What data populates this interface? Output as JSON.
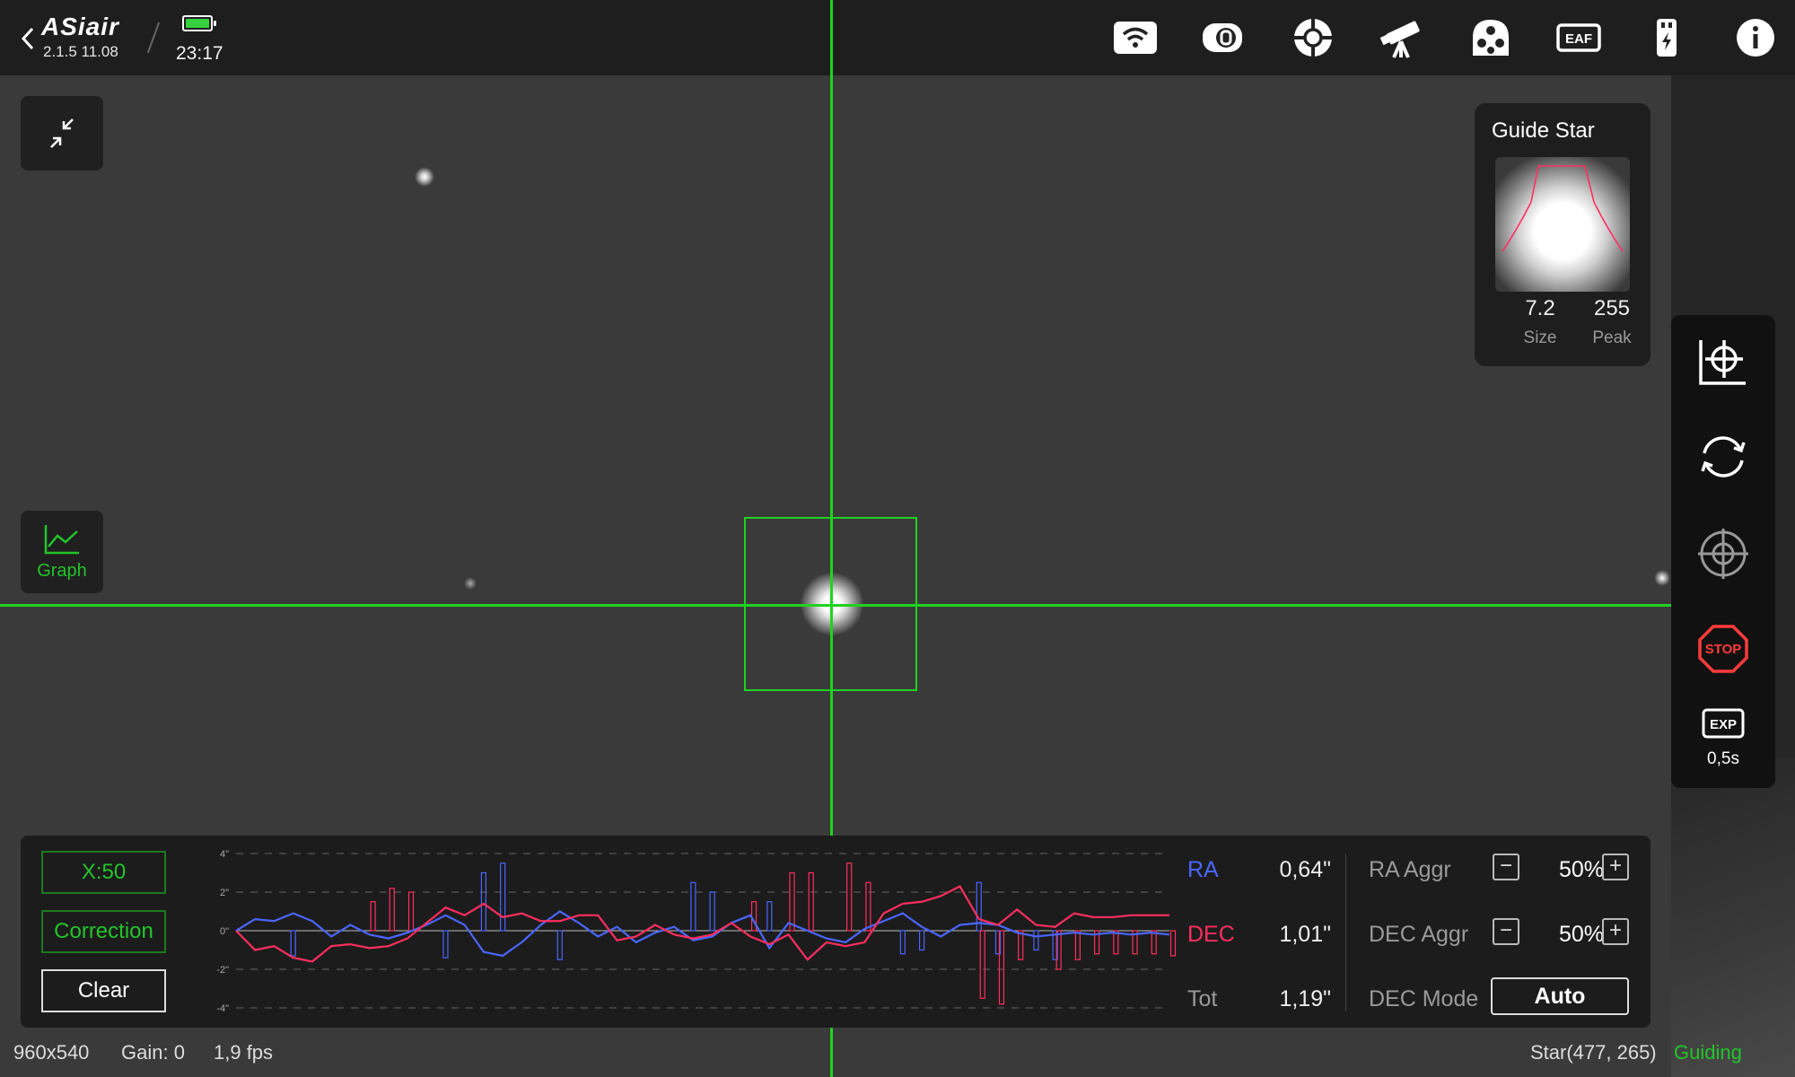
{
  "app": {
    "logo": "ASiair",
    "version": "2.1.5 11.08",
    "time": "23:17"
  },
  "top_icons": [
    "wifi-icon",
    "camera-icon",
    "guide-camera-icon",
    "telescope-icon",
    "filter-wheel-icon",
    "focuser-icon",
    "storage-icon",
    "info-icon"
  ],
  "top_icon_labels": {
    "focuser": "EAF"
  },
  "guide_star": {
    "title": "Guide Star",
    "size_value": "7.2",
    "size_label": "Size",
    "peak_value": "255",
    "peak_label": "Peak"
  },
  "graph_button": {
    "label": "Graph"
  },
  "panel": {
    "x_scale": "X:50",
    "correction": "Correction",
    "clear": "Clear",
    "ra_label": "RA",
    "ra_value": "0,64\"",
    "dec_label": "DEC",
    "dec_value": "1,01\"",
    "tot_label": "Tot",
    "tot_value": "1,19\"",
    "ra_aggr_label": "RA Aggr",
    "ra_aggr_value": "50%",
    "dec_aggr_label": "DEC Aggr",
    "dec_aggr_value": "50%",
    "dec_mode_label": "DEC Mode",
    "dec_mode_value": "Auto"
  },
  "side_tools": {
    "exp_label": "EXP",
    "exp_value": "0,5s",
    "stop_label": "STOP"
  },
  "status": {
    "resolution": "960x540",
    "gain": "Gain: 0",
    "fps": "1,9 fps",
    "star": "Star(477, 265)",
    "state": "Guiding"
  },
  "colors": {
    "green": "#1fd31f",
    "ra": "#4a66ff",
    "dec": "#ff2e5f",
    "stop": "#ff3b3b"
  },
  "chart_data": {
    "type": "line",
    "y_ticks": [
      "4\"",
      "2\"",
      "0\"",
      "-2\"",
      "-4\""
    ],
    "ylim": [
      -4,
      4
    ],
    "series": [
      {
        "name": "RA",
        "values": [
          0,
          0.6,
          0.5,
          0.9,
          0.5,
          -0.3,
          0.3,
          -0.2,
          -0.4,
          -0.1,
          0.3,
          0.8,
          0.3,
          -1.1,
          -1.3,
          -0.6,
          0.3,
          1.0,
          0.4,
          -0.3,
          0.2,
          -0.6,
          -0.1,
          0.2,
          -0.5,
          -0.3,
          0.4,
          0.8,
          -0.9,
          0.4,
          0.0,
          -0.4,
          -0.6,
          0.1,
          0.5,
          0.9,
          0.2,
          -0.3,
          0.3,
          0.4,
          0.3,
          -0.1,
          -0.3,
          -0.2,
          -0.1,
          -0.2,
          -0.1,
          -0.2,
          -0.1,
          -0.2
        ]
      },
      {
        "name": "DEC",
        "values": [
          0,
          -1.0,
          -0.8,
          -1.4,
          -1.6,
          -0.8,
          -0.7,
          -0.9,
          -0.8,
          -0.4,
          0.4,
          1.2,
          0.8,
          1.4,
          0.7,
          0.9,
          0.5,
          0.5,
          0.8,
          0.8,
          -0.5,
          -0.3,
          0.3,
          -0.2,
          -0.4,
          -0.2,
          0.4,
          -0.3,
          -0.7,
          -0.2,
          -1.5,
          -0.6,
          -0.8,
          -0.6,
          0.9,
          1.4,
          1.5,
          1.8,
          2.3,
          0.6,
          0.3,
          1.1,
          0.3,
          0.2,
          0.9,
          0.7,
          0.7,
          0.8,
          0.8,
          0.8
        ]
      },
      {
        "name": "RA correction",
        "values": [
          0,
          0,
          0,
          -1.3,
          0,
          0,
          0,
          0,
          0,
          0,
          0,
          -1.4,
          0,
          3.0,
          3.5,
          0,
          0,
          -1.5,
          0,
          0,
          0,
          0,
          0,
          0,
          2.5,
          2.0,
          0,
          0,
          1.5,
          0,
          0,
          0,
          0,
          0,
          0,
          -1.2,
          -1.0,
          0,
          0,
          2.5,
          -1.2,
          0,
          -1.0,
          -1.5,
          0,
          0,
          0,
          0,
          0,
          0
        ]
      },
      {
        "name": "DEC correction",
        "values": [
          0,
          0,
          0,
          0,
          0,
          0,
          0,
          1.5,
          2.2,
          2.0,
          0,
          0,
          0,
          0,
          0,
          0,
          0,
          0,
          0,
          0,
          0,
          0,
          0,
          0,
          0,
          0,
          0,
          1.5,
          0,
          3.0,
          3.0,
          0,
          3.5,
          2.5,
          0,
          0,
          0,
          0,
          0,
          -3.5,
          -3.8,
          -1.5,
          0,
          -2.0,
          -1.5,
          -1.2,
          -1.2,
          -1.2,
          -1.2,
          -1.3
        ]
      }
    ]
  }
}
